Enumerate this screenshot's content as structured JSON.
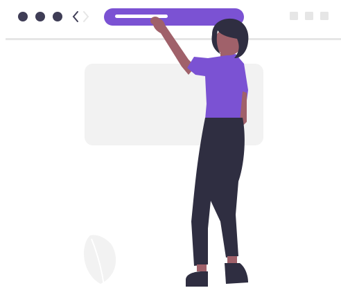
{
  "browser": {
    "window_dots": [
      "dot-1",
      "dot-2",
      "dot-3"
    ],
    "nav_icons": [
      "chevron-left-icon",
      "chevron-right-icon"
    ],
    "window_buttons": [
      "square-1",
      "square-2",
      "square-3"
    ],
    "address_bar": {
      "text": ""
    }
  },
  "colors": {
    "accent": "#7b52d3",
    "dark": "#2f2e41",
    "skin": "#a0616a",
    "hair": "#2f2e41",
    "placeholder": "#f2f2f2",
    "divider": "#e6e6e6",
    "chevron_active": "#3f3d56",
    "chevron_inactive": "#e6e6e6",
    "window_button": "#e6e6e6",
    "leaf": "#f2f2f2"
  },
  "illustration": {
    "figure": "woman-reaching-address-bar",
    "leaf": "leaf-plant"
  }
}
